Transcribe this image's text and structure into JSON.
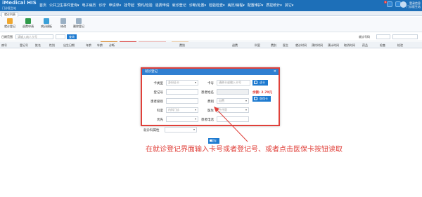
{
  "app": {
    "brand": "iMedical HIS",
    "sub": "门诊医生站"
  },
  "menu": [
    "首页",
    "公共卫生事件查询▾",
    "电子病历",
    "诊疗",
    "申请单▾",
    "挂号起",
    "预约/检验",
    "退费申请",
    "就诊登记",
    "诊断/处置▾",
    "检验检查▾",
    "病历/病程▾",
    "配置维护▾",
    "质控统计▾",
    "其它▾"
  ],
  "topbar_badge": "3",
  "user": {
    "line1": "登录信息",
    "line2": "门诊医生站"
  },
  "tab": "就诊列表",
  "toolbar": {
    "buttons": [
      "就诊登记",
      "退费申请",
      "病历模板",
      "修改",
      "删除登记"
    ],
    "legend": [
      "未就诊(0)",
      "已就诊(0)",
      "已退号(未收款)(0)",
      "有费用(0)"
    ]
  },
  "filter": {
    "label1": "日期范围",
    "placeholder1": "请输入病人卡号",
    "search_label": "查询",
    "label2": "就诊号码"
  },
  "grid_headers": [
    "病号",
    "登记号",
    "姓名",
    "性别",
    "出生日期",
    "年龄",
    "年龄",
    "诊断",
    "费别",
    "退费",
    "科室",
    "费别",
    "医生",
    "就诊时间",
    "预约时间",
    "预计时间",
    "取消时间",
    "药品",
    "检查",
    "检验"
  ],
  "dialog": {
    "title": "就诊登记",
    "close": "✕",
    "card_type_label": "卡类型",
    "card_type_value": "身份证卡",
    "card_no_label": "卡号",
    "card_no_value": "请刷卡或输入卡号",
    "read_card_button": "读卡",
    "reg_no_label": "登记号",
    "reg_no_value": "",
    "patient_name_label": "患者姓名",
    "patient_name_value": "",
    "balance_text": "余额: 2.70元",
    "patient_level_label": "患者级别",
    "patient_level_value": "",
    "fee_type_label": "费别",
    "fee_type_value": "自费",
    "med_card_button": "医保卡",
    "dept_label": "科室",
    "dept_value": "内科门诊",
    "doctor_label": "医生",
    "doctor_value": "主任医",
    "priority_label": "优先",
    "priority_value": "",
    "patient_phone_label": "患者电话",
    "patient_phone_value": "",
    "remark_label": "就诊科属性",
    "remark_value": "",
    "save_button": "保存"
  },
  "annotation": "在就诊登记界面输入卡号或者登记号、或者点击医保卡按钮读取",
  "colors": {
    "topbar": "#1d6fb8",
    "accent": "#1d7ad0",
    "highlight": "#e0403a"
  }
}
